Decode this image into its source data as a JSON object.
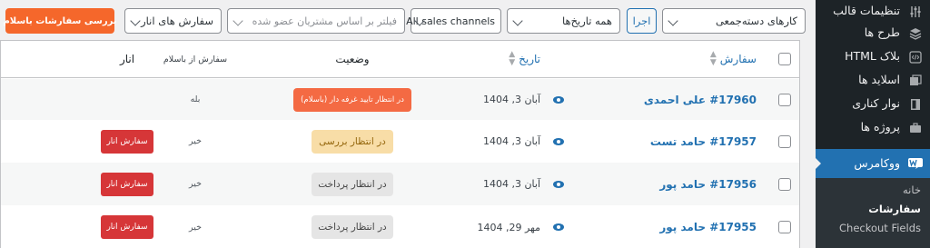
{
  "filters": {
    "bulk_actions": "کارهای دسته‌جمعی",
    "apply": "اجرا",
    "all_dates": "همه تاریخ‌ها",
    "sales_channels": "All sales channels",
    "customer_placeholder": "فیلتر بر اساس مشتریان عضو شده",
    "order_sources": "سفارش های انار",
    "review_button": "بررسی سفارشات باسلام"
  },
  "table": {
    "headers": {
      "order": "سفارش",
      "date": "تاریخ",
      "status": "وضعیت",
      "from_basalam": "سفارش از باسلام",
      "anar": "انار"
    },
    "rows": [
      {
        "order": "#17960 علی احمدی",
        "date": "آبان 3, 1404",
        "status": "در انتظار تایید غرفه دار (باسلام)",
        "status_color": "#f46a43",
        "from_basalam": "بله",
        "anar_button": ""
      },
      {
        "order": "#17957 حامد تست",
        "date": "آبان 3, 1404",
        "status": "در انتظار بررسی",
        "status_color": "#f8dda7",
        "from_basalam": "خیر",
        "anar_button": "سفارش انار"
      },
      {
        "order": "#17956 حامد پور",
        "date": "آبان 3, 1404",
        "status": "در انتظار پرداخت",
        "status_color": "#e5e5e5",
        "from_basalam": "خیر",
        "anar_button": "سفارش انار"
      },
      {
        "order": "#17955 حامد پور",
        "date": "مهر 29, 1404",
        "status": "در انتظار پرداخت",
        "status_color": "#e5e5e5",
        "from_basalam": "خیر",
        "anar_button": "سفارش انار"
      }
    ]
  },
  "sidebar": {
    "items": [
      {
        "label": "تنظیمات قالب",
        "icon": "sliders-icon"
      },
      {
        "label": "طرح ها",
        "icon": "layers-icon"
      },
      {
        "label": "بلاک HTML",
        "icon": "code-icon"
      },
      {
        "label": "اسلاید ها",
        "icon": "slides-icon"
      },
      {
        "label": "نوار کناری",
        "icon": "sidebar-icon"
      },
      {
        "label": "پروژه ها",
        "icon": "briefcase-icon"
      }
    ],
    "active": {
      "label": "ووکامرس",
      "icon": "woocommerce-icon"
    },
    "submenu": [
      "خانه",
      "سفارشات",
      "Checkout Fields"
    ]
  },
  "colors": {
    "accent": "#2271b1",
    "sidebar_bg": "#1d2327",
    "review_button": "#f5672b",
    "anar_button": "#d63638"
  }
}
